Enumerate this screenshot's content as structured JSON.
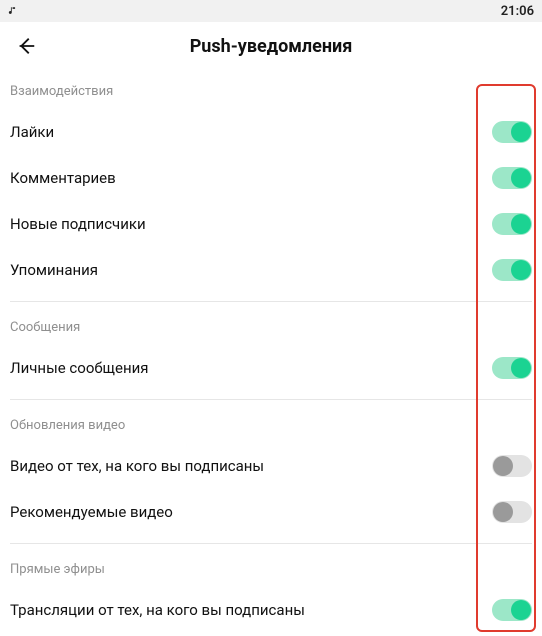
{
  "status": {
    "time": "21:06"
  },
  "header": {
    "title": "Push-уведомления"
  },
  "sections": {
    "interactions": {
      "title": "Взаимодействия",
      "likes": "Лайки",
      "comments": "Комментариев",
      "new_followers": "Новые подписчики",
      "mentions": "Упоминания"
    },
    "messages": {
      "title": "Сообщения",
      "dm": "Личные сообщения"
    },
    "video_updates": {
      "title": "Обновления видео",
      "from_followed": "Видео от тех, на кого вы подписаны",
      "recommended": "Рекомендуемые видео"
    },
    "live": {
      "title": "Прямые эфиры",
      "broadcasts": "Трансляции от тех, на кого вы подписаны"
    }
  },
  "toggles": {
    "likes": true,
    "comments": true,
    "new_followers": true,
    "mentions": true,
    "dm": true,
    "video_from_followed": false,
    "recommended": false,
    "live_broadcasts": true
  }
}
